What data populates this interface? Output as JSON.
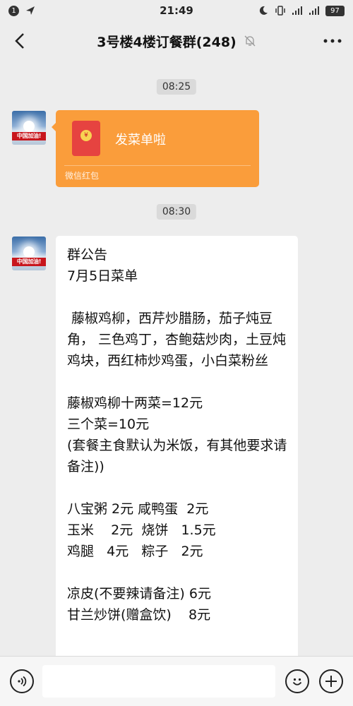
{
  "status_bar": {
    "time": "21:49",
    "battery": "97",
    "left_badge": "1"
  },
  "header": {
    "title": "3号楼4楼订餐群(248)",
    "icons": [
      "back-arrow",
      "mute-bell",
      "more-dots"
    ]
  },
  "messages": [
    {
      "time": "08:25",
      "type": "red-packet",
      "title": "发菜单啦",
      "footer": "微信红包",
      "avatar_text": "中国加油!"
    },
    {
      "time": "08:30",
      "type": "text",
      "avatar_text": "中国加油!",
      "text": "群公告\n7月5日菜单\n\n 藤椒鸡柳，西芹炒腊肠，茄子炖豆角， 三色鸡丁，杏鲍菇炒肉，土豆炖鸡块，西红柿炒鸡蛋，小白菜粉丝\n\n藤椒鸡柳十两菜=12元\n三个菜=10元\n(套餐主食默认为米饭，有其他要求请备注))\n\n八宝粥 2元 咸鸭蛋  2元\n玉米    2元  烧饼   1.5元\n鸡腿   4元   粽子   2元\n\n凉皮(不要辣请备注) 6元\n甘兰炒饼(赠盒饮)    8元"
    }
  ],
  "input_bar": {
    "placeholder": "",
    "icons": [
      "voice-icon",
      "emoji-icon",
      "plus-icon"
    ]
  },
  "colors": {
    "background": "#ededed",
    "red_packet": "#fa9d3b",
    "bubble": "#ffffff"
  }
}
